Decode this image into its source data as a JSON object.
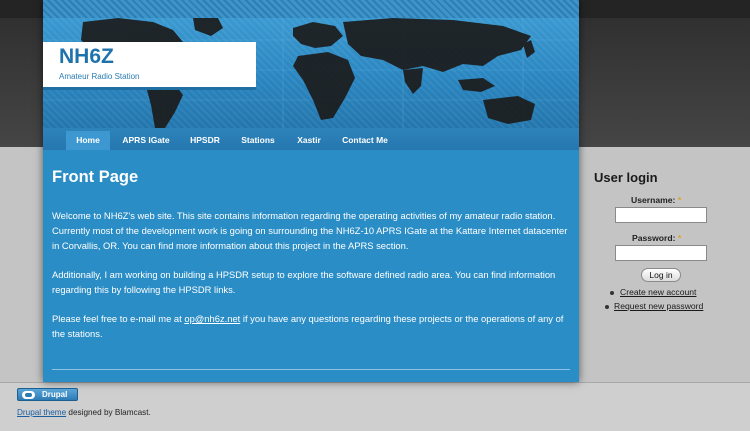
{
  "site": {
    "name": "NH6Z",
    "slogan": "Amateur Radio Station"
  },
  "nav": {
    "items": [
      {
        "label": "Home",
        "active": true
      },
      {
        "label": "APRS IGate"
      },
      {
        "label": "HPSDR"
      },
      {
        "label": "Stations"
      },
      {
        "label": "Xastir"
      },
      {
        "label": "Contact Me"
      }
    ]
  },
  "content": {
    "title": "Front Page",
    "p1": "Welcome to NH6Z's web site. This site contains information regarding the operating activities of my amateur radio station. Currently most of the development work is going on surrounding the NH6Z-10 APRS IGate at the Kattare Internet datacenter in Corvallis, OR. You can find more information about this project in the APRS section.",
    "p2": "Additionally, I am working on building a HPSDR setup to explore the software defined radio area. You can find information regarding this by following the HPSDR links.",
    "p3_before": "Please feel free to e-mail me at ",
    "p3_email": "op@nh6z.net",
    "p3_after": " if you have any questions regarding these projects or the operations of any of the stations."
  },
  "sidebar": {
    "title": "User login",
    "username_label": "Username:",
    "password_label": "Password:",
    "required_mark": "*",
    "login_button": "Log in",
    "links": [
      "Create new account",
      "Request new password"
    ]
  },
  "footer": {
    "badge_text": "Drupal",
    "theme_link": "Drupal theme",
    "credit_text": " designed by Blamcast."
  },
  "colors": {
    "content_bg": "#2a8dc6",
    "header_dark": "#2d2d2d",
    "page_bg": "#c4c4c4"
  }
}
